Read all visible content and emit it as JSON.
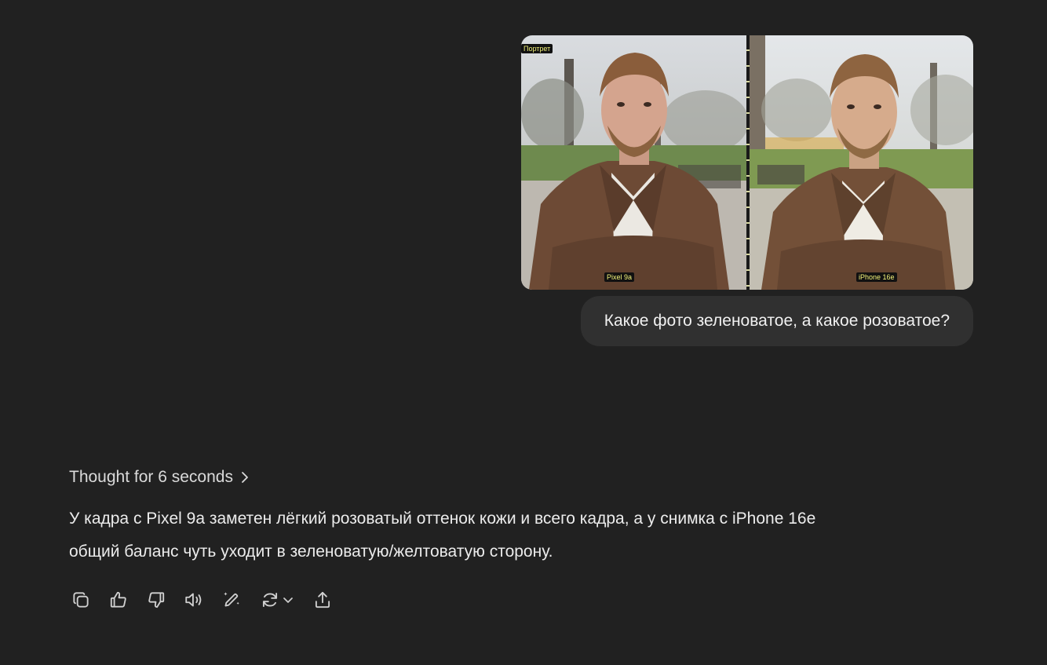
{
  "conversation": {
    "user_message": {
      "image": {
        "tag_portrait": "Портрет",
        "label_left": "Pixel 9a",
        "label_right": "iPhone 16e"
      },
      "text": "Какое фото зеленоватое, а какое розоватое?"
    },
    "assistant_message": {
      "thought_label": "Thought for 6 seconds",
      "answer_lines": [
        "У кадра с Pixel 9a заметен лёгкий розоватый оттенок кожи и всего кадра, а у снимка с iPhone 16e",
        "общий баланс чуть уходит в зеленоватую/желтоватую сторону."
      ]
    },
    "actions": {
      "icons": [
        "copy-icon",
        "thumbs-up-icon",
        "thumbs-down-icon",
        "read-aloud-icon",
        "edit-icon",
        "regenerate-icon",
        "share-icon"
      ]
    }
  },
  "colors": {
    "background": "#212121",
    "bubble": "#303030",
    "text": "#ececec",
    "photo_tag_text": "#f3f37a"
  }
}
